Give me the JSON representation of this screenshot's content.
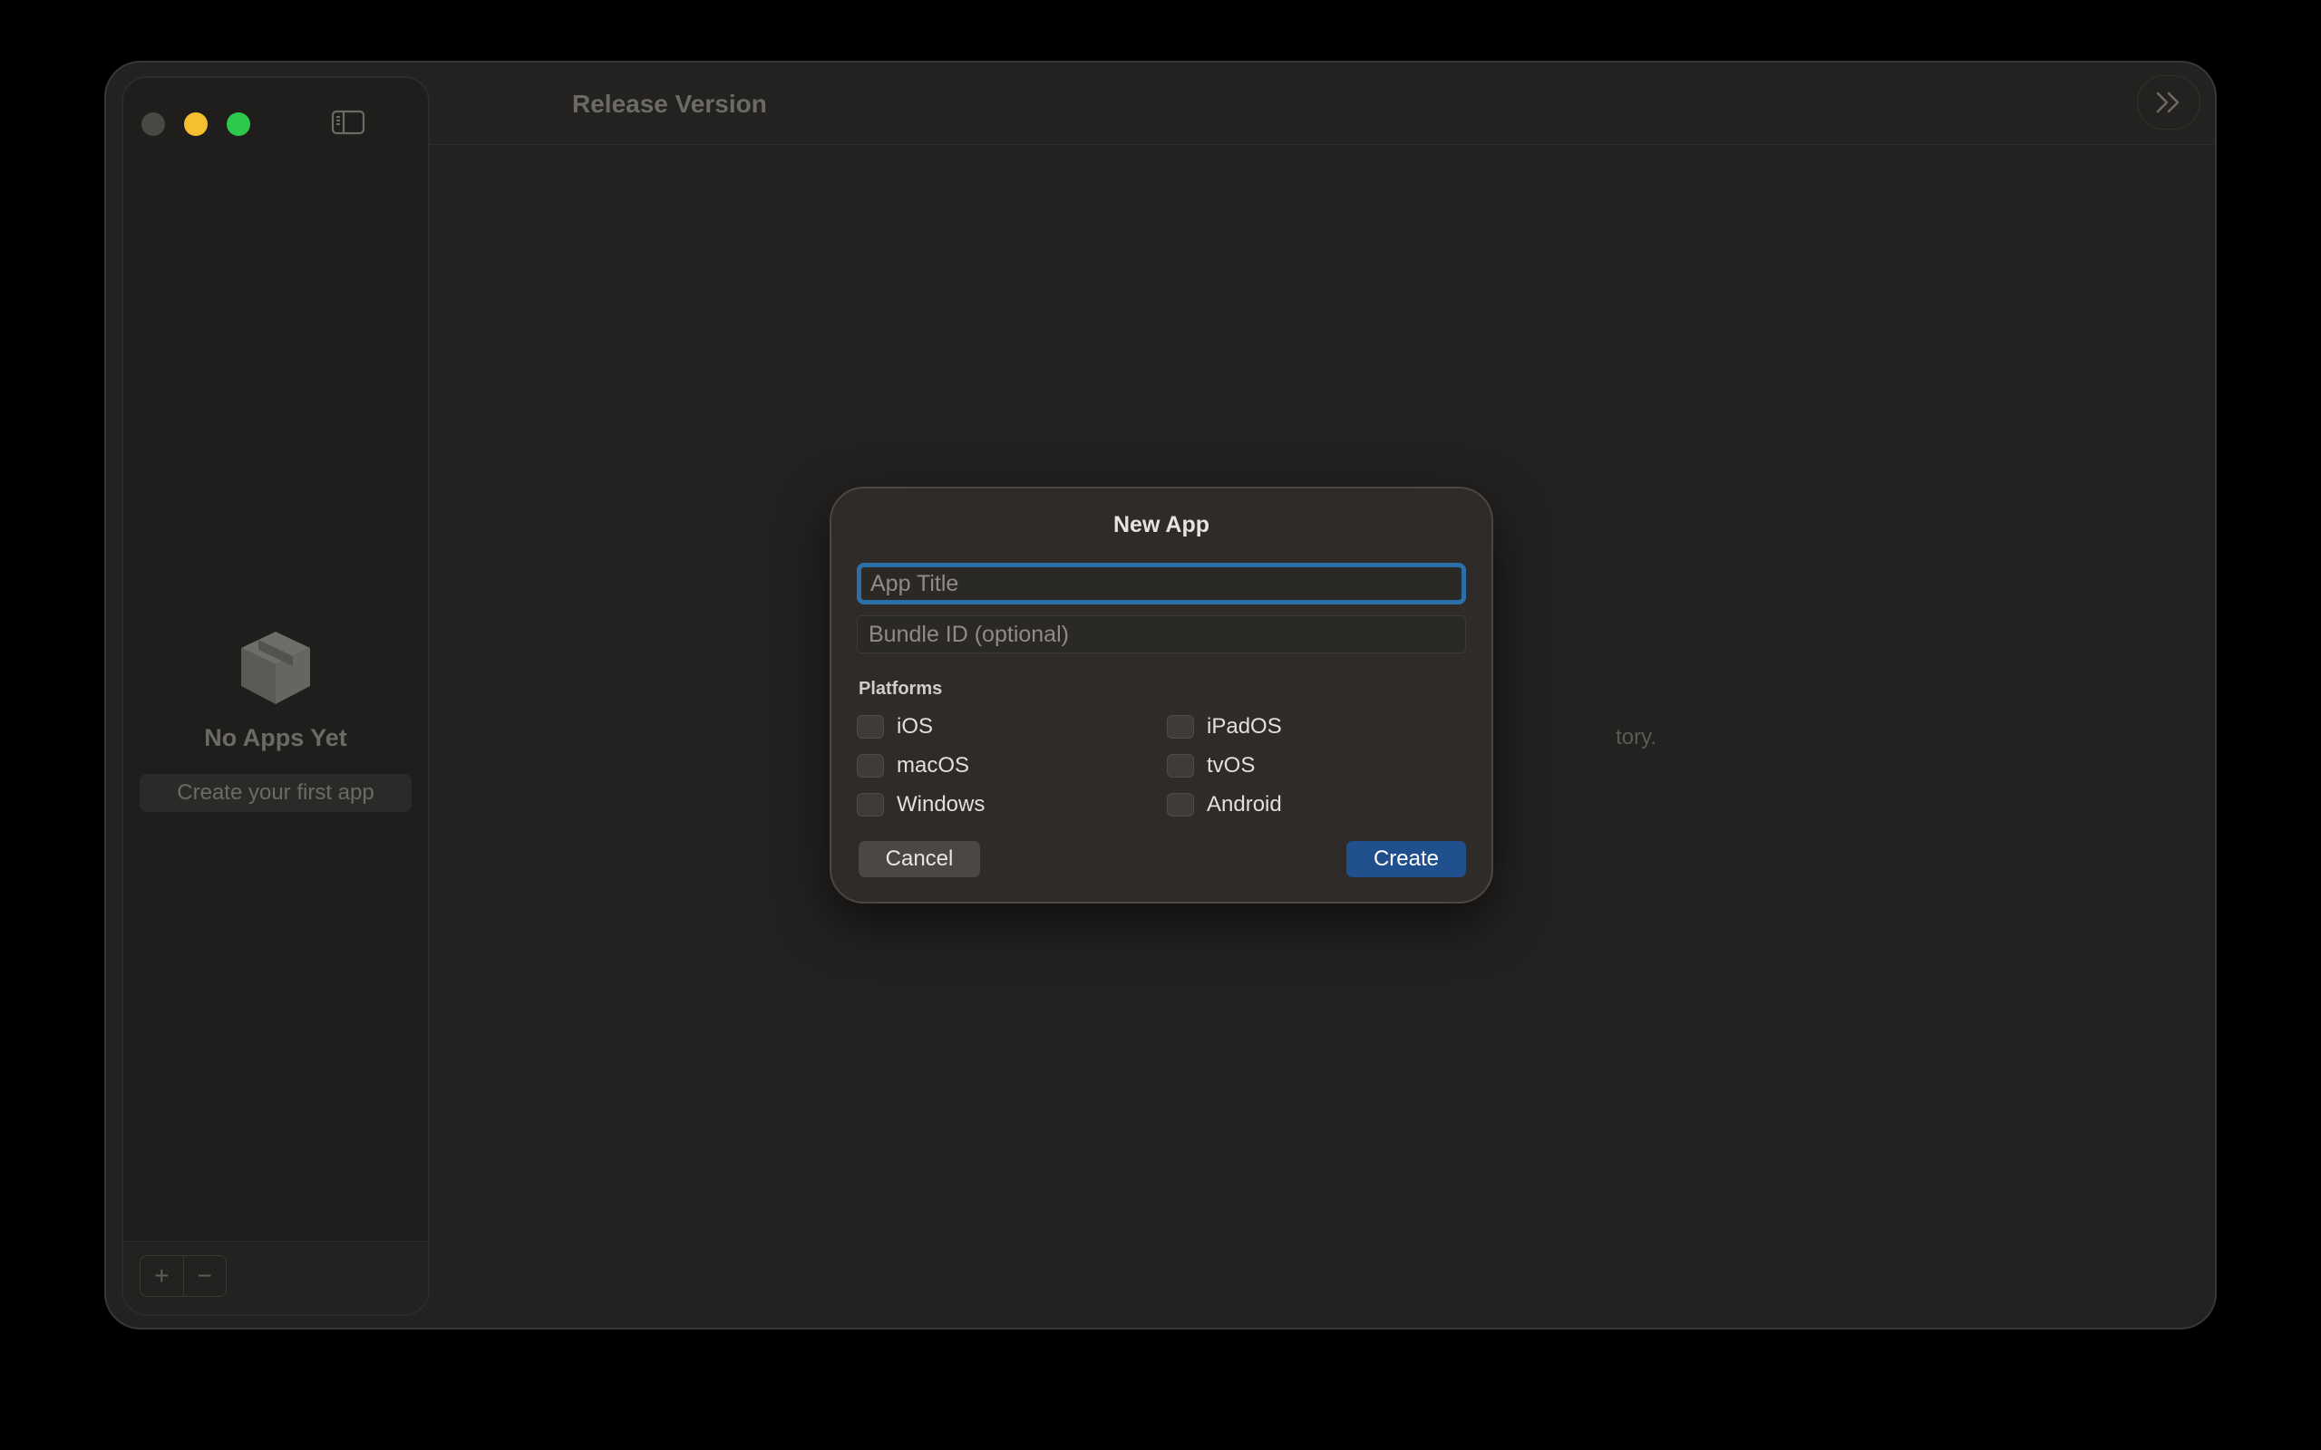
{
  "window": {
    "title": "Release Version"
  },
  "sidebar": {
    "empty_title": "No Apps Yet",
    "empty_action": "Create your first app",
    "add_label": "+",
    "remove_label": "−"
  },
  "main": {
    "hint_fragment": "tory."
  },
  "dialog": {
    "title": "New App",
    "app_title_placeholder": "App Title",
    "bundle_id_placeholder": "Bundle ID (optional)",
    "platforms_label": "Platforms",
    "platforms": [
      {
        "label": "iOS",
        "checked": false
      },
      {
        "label": "iPadOS",
        "checked": false
      },
      {
        "label": "macOS",
        "checked": false
      },
      {
        "label": "tvOS",
        "checked": false
      },
      {
        "label": "Windows",
        "checked": false
      },
      {
        "label": "Android",
        "checked": false
      }
    ],
    "cancel_label": "Cancel",
    "create_label": "Create"
  },
  "colors": {
    "accent_blue": "#1f4f8c",
    "focus_ring": "#2a6fa8",
    "traffic_minimize": "#f6bf2f",
    "traffic_maximize": "#2cc94b",
    "traffic_close_inactive": "#4a4845"
  }
}
